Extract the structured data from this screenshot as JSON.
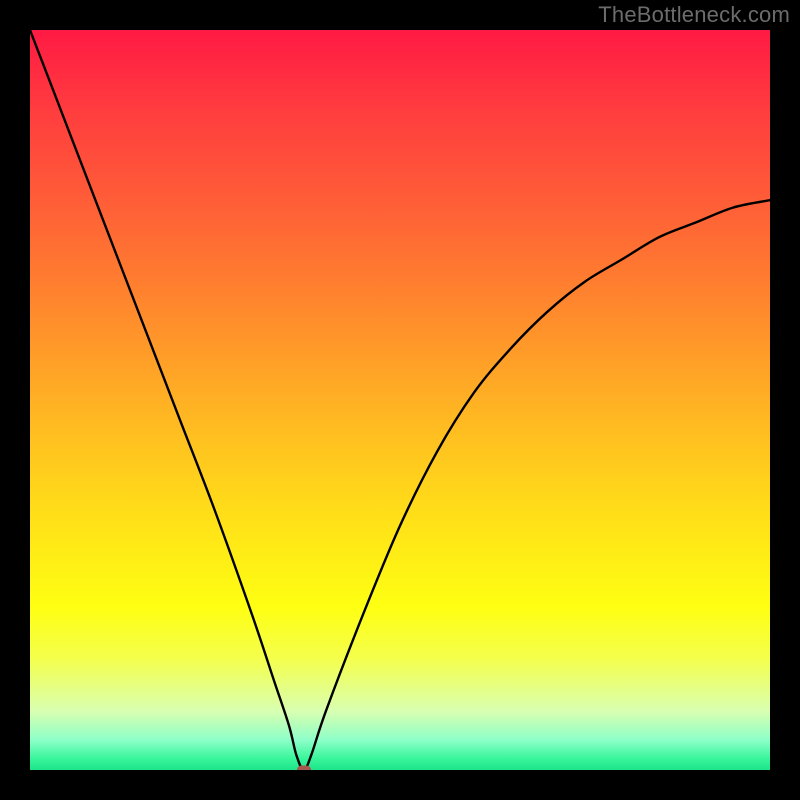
{
  "watermark": "TheBottleneck.com",
  "chart_data": {
    "type": "line",
    "title": "",
    "xlabel": "",
    "ylabel": "",
    "xlim": [
      0,
      100
    ],
    "ylim": [
      0,
      100
    ],
    "grid": false,
    "legend": false,
    "series": [
      {
        "name": "bottleneck-curve",
        "x": [
          0,
          5,
          10,
          15,
          20,
          25,
          30,
          33,
          35,
          36,
          37,
          38,
          40,
          45,
          50,
          55,
          60,
          65,
          70,
          75,
          80,
          85,
          90,
          95,
          100
        ],
        "y": [
          100,
          87,
          74,
          61,
          48,
          35,
          21,
          12,
          6,
          2,
          0,
          2,
          8,
          21,
          33,
          43,
          51,
          57,
          62,
          66,
          69,
          72,
          74,
          76,
          77
        ]
      }
    ],
    "marker": {
      "x": 37,
      "y": 0
    },
    "background_gradient": {
      "direction": "top-to-bottom",
      "stops": [
        {
          "pct": 0,
          "color": "#ff1a44"
        },
        {
          "pct": 50,
          "color": "#ffc020"
        },
        {
          "pct": 78,
          "color": "#feff12"
        },
        {
          "pct": 100,
          "color": "#1ee58a"
        }
      ]
    }
  }
}
